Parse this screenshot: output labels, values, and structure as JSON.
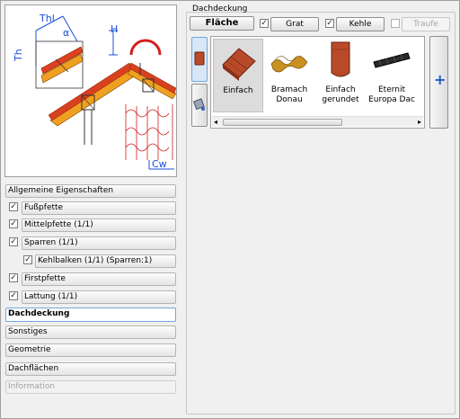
{
  "preview": {
    "labels": {
      "thl": "Thl",
      "th": "Th",
      "h": "H",
      "cw": "Cw",
      "alpha": "α"
    }
  },
  "properties": [
    {
      "label": "Allgemeine Eigenschaften",
      "checkbox": false,
      "indent": 0,
      "state": "normal"
    },
    {
      "label": "Fußpfette",
      "checkbox": true,
      "indent": 1,
      "state": "normal"
    },
    {
      "label": "Mittelpfette (1/1)",
      "checkbox": true,
      "indent": 1,
      "state": "normal"
    },
    {
      "label": "Sparren (1/1)",
      "checkbox": true,
      "indent": 1,
      "state": "normal"
    },
    {
      "label": "Kehlbalken (1/1) (Sparren:1)",
      "checkbox": true,
      "indent": 2,
      "state": "normal"
    },
    {
      "label": "Firstpfette",
      "checkbox": true,
      "indent": 1,
      "state": "normal"
    },
    {
      "label": "Lattung (1/1)",
      "checkbox": true,
      "indent": 1,
      "state": "normal"
    },
    {
      "label": "Dachdeckung",
      "checkbox": false,
      "indent": 0,
      "state": "active"
    },
    {
      "label": "Sonstiges",
      "checkbox": false,
      "indent": 0,
      "state": "normal"
    },
    {
      "label": "Geometrie",
      "checkbox": false,
      "indent": 0,
      "state": "normal"
    },
    {
      "label": "Dachflächen",
      "checkbox": false,
      "indent": 0,
      "state": "normal"
    },
    {
      "label": "Information",
      "checkbox": false,
      "indent": 0,
      "state": "disabled"
    }
  ],
  "dachdeckung": {
    "group_label": "Dachdeckung",
    "flaeche_label": "Fläche",
    "grat": {
      "label": "Grat",
      "checked": true
    },
    "kehle": {
      "label": "Kehle",
      "checked": true
    },
    "traufe": {
      "label": "Traufe",
      "checked": false,
      "enabled": false
    },
    "check_mark": "✓",
    "tiles": [
      {
        "label": "Einfach",
        "selected": true,
        "icon": "flat-tile-icon"
      },
      {
        "label": "Bramach Donau",
        "selected": false,
        "icon": "wave-tile-icon"
      },
      {
        "label": "Einfach gerundet",
        "selected": false,
        "icon": "rounded-tile-icon"
      },
      {
        "label": "Eternit Europa Dac",
        "selected": false,
        "icon": "eternit-tile-icon"
      }
    ],
    "add_button_icon": "plus-icon",
    "scroll_left": "◂",
    "scroll_right": "▸",
    "add_symbol": "+"
  },
  "colors": {
    "accent": "#1f5fbf",
    "tile_red": "#b84a2a",
    "beam_orange": "#f0a020",
    "dim_blue": "#1a4fd8"
  }
}
